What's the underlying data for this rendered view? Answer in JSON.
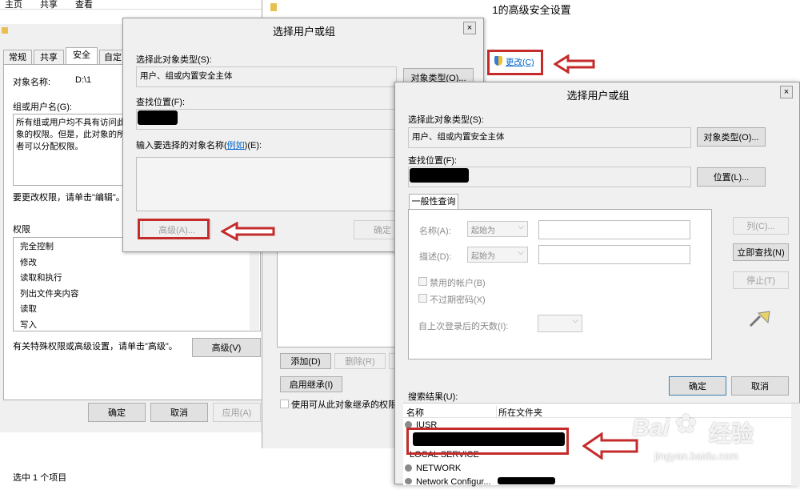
{
  "explorer": {
    "tabs": [
      "主页",
      "共享",
      "查看"
    ],
    "status": "选中 1 个项目"
  },
  "props": {
    "tabs": [
      "常规",
      "共享",
      "安全",
      "自定义"
    ],
    "object_name_label": "对象名称:",
    "object_name_value": "D:\\1",
    "group_label": "组或用户名(G):",
    "group_text": "所有组或用户均不具有访问此对象的权限。但是，此对象的所有者可以分配权限。",
    "edit_hint": "要更改权限，请单击\"编辑\"。",
    "perm_label": "权限",
    "permissions": [
      "完全控制",
      "修改",
      "读取和执行",
      "列出文件夹内容",
      "读取",
      "写入"
    ],
    "advanced_hint": "有关特殊权限或高级设置，请单击\"高级\"。",
    "advanced_button": "高级(V)",
    "ok": "确定",
    "cancel": "取消",
    "apply": "应用(A)"
  },
  "adv": {
    "title": "1的高级安全设置",
    "change_link": "更改(C)",
    "add": "添加(D)",
    "remove": "删除(R)",
    "enable_inheritance": "启用继承(I)",
    "replace_check": "使用可从此对象继承的权限"
  },
  "select1": {
    "title": "选择用户或组",
    "type_label": "选择此对象类型(S):",
    "type_value": "用户、组或内置安全主体",
    "type_button": "对象类型(O)...",
    "location_label": "查找位置(F):",
    "enter_label_pre": "输入要选择的对象名称(",
    "enter_label_link": "例如",
    "enter_label_post": ")(E):",
    "advanced_button": "高级(A)...",
    "ok": "确定"
  },
  "select2": {
    "title": "选择用户或组",
    "type_label": "选择此对象类型(S):",
    "type_value": "用户、组或内置安全主体",
    "type_button": "对象类型(O)...",
    "location_label": "查找位置(F):",
    "location_button": "位置(L)...",
    "tab_label": "一般性查询",
    "name_label": "名称(A):",
    "name_combo": "起始为",
    "desc_label": "描述(D):",
    "desc_combo": "起始为",
    "disabled_accounts": "禁用的帐户(B)",
    "no_expire": "不过期密码(X)",
    "days_label": "自上次登录后的天数(I):",
    "columns_button": "列(C)...",
    "find_now_button": "立即查找(N)",
    "stop_button": "停止(T)",
    "ok": "确定",
    "cancel": "取消",
    "results_label": "搜索结果(U):",
    "col_name": "名称",
    "col_folder": "所在文件夹",
    "results": [
      "IUSR",
      "",
      "LOCAL SERVICE",
      "NETWORK",
      "Network Configur..."
    ]
  },
  "watermark": {
    "brand": "Bai",
    "brand2": "经验",
    "url": "jingyan.baidu.com"
  },
  "colors": {
    "annotation_red": "#c42b2b",
    "link_blue": "#0066cc"
  }
}
